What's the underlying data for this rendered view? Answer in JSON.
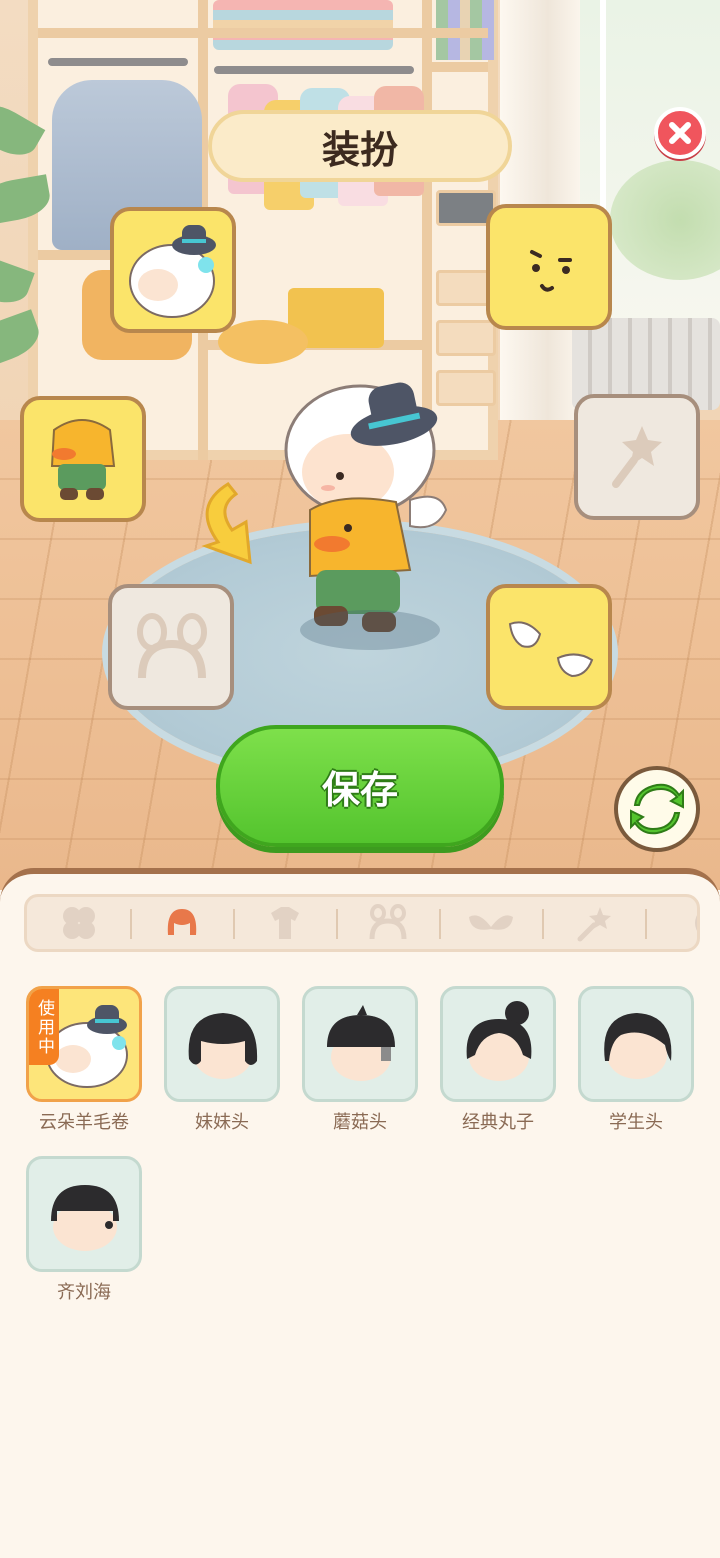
{
  "header": {
    "title": "装扮",
    "close_icon": "close-icon"
  },
  "actions": {
    "save_label": "保存",
    "refresh_icon": "refresh-icon"
  },
  "slots": [
    {
      "id": "hair",
      "filled": true,
      "icon": "cloud-hair-icon"
    },
    {
      "id": "face",
      "filled": true,
      "icon": "smirk-face-icon"
    },
    {
      "id": "outfit",
      "filled": true,
      "icon": "duck-outfit-icon"
    },
    {
      "id": "handheld",
      "filled": false,
      "icon": "star-wand-icon"
    },
    {
      "id": "headband",
      "filled": false,
      "icon": "bunny-headband-icon"
    },
    {
      "id": "wings",
      "filled": true,
      "icon": "angel-wings-icon"
    }
  ],
  "tabs": [
    {
      "icon": "clover-icon",
      "active": false
    },
    {
      "icon": "hair-icon",
      "active": true
    },
    {
      "icon": "clothes-icon",
      "active": false
    },
    {
      "icon": "headband-icon",
      "active": false
    },
    {
      "icon": "wings-icon",
      "active": false
    },
    {
      "icon": "wand-icon",
      "active": false
    },
    {
      "icon": "face-icon",
      "active": false
    }
  ],
  "items": [
    {
      "name": "云朵羊毛卷",
      "selected": true,
      "badge": "使用中"
    },
    {
      "name": "妹妹头",
      "selected": false
    },
    {
      "name": "蘑菇头",
      "selected": false
    },
    {
      "name": "经典丸子",
      "selected": false
    },
    {
      "name": "学生头",
      "selected": false
    },
    {
      "name": "齐刘海",
      "selected": false
    }
  ],
  "colors": {
    "accent": "#f58021",
    "save": "#5ccf35",
    "close": "#f0555d",
    "active_tab": "#e8784a"
  }
}
